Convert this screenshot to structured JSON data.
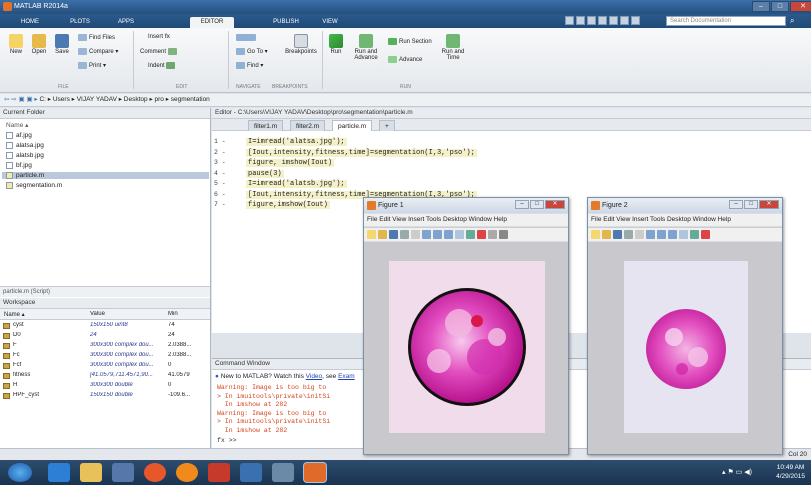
{
  "window": {
    "title": "MATLAB R2014a"
  },
  "tabs": [
    {
      "label": "HOME"
    },
    {
      "label": "PLOTS"
    },
    {
      "label": "APPS"
    },
    {
      "label": "EDITOR"
    },
    {
      "label": "PUBLISH"
    },
    {
      "label": "VIEW"
    }
  ],
  "search": {
    "placeholder": "Search Documentation"
  },
  "ribbon": {
    "new": "New",
    "open": "Open",
    "save": "Save",
    "find_files": "Find Files",
    "compare": "Compare ▾",
    "print": "Print ▾",
    "insert": "Insert",
    "comment": "Comment",
    "indent": "Indent",
    "go_to": "Go To ▾",
    "find": "Find ▾",
    "breakpoints": "Breakpoints",
    "run": "Run",
    "run_and_advance": "Run and Advance",
    "run_section": "Run Section",
    "advance": "Advance",
    "run_and_time": "Run and Time",
    "sections": {
      "file": "FILE",
      "edit": "EDIT",
      "navigate": "NAVIGATE",
      "breakpoints": "BREAKPOINTS",
      "run": "RUN"
    }
  },
  "path": {
    "crumbs": "C: ▸ Users ▸ VIJAY YADAV ▸ Desktop ▸ pro ▸ segmentation"
  },
  "current_folder": {
    "title": "Current Folder",
    "name_header": "Name ▴",
    "files": [
      "af.jpg",
      "alatsa.jpg",
      "alatsb.jpg",
      "bf.jpg",
      "particle.m",
      "segmentation.m"
    ],
    "selected": "particle.m",
    "details": "particle.m (Script)"
  },
  "workspace": {
    "title": "Workspace",
    "headers": [
      "Name ▴",
      "Value",
      "Min"
    ],
    "rows": [
      {
        "name": "cyst",
        "value": "150x150 uint8",
        "min": "74"
      },
      {
        "name": "D0",
        "value": "24",
        "min": "24"
      },
      {
        "name": "F",
        "value": "300x300 complex dou...",
        "min": "2.0388..."
      },
      {
        "name": "Fc",
        "value": "300x300 complex dou...",
        "min": "2.0388..."
      },
      {
        "name": "Fcf",
        "value": "300x300 complex dou...",
        "min": "0"
      },
      {
        "name": "fitness",
        "value": "[41.0579,711.4571,90...",
        "min": "41.0579"
      },
      {
        "name": "H",
        "value": "300x300 double",
        "min": "0"
      },
      {
        "name": "HPF_cyst",
        "value": "150x150 double",
        "min": "-109.6..."
      }
    ]
  },
  "editor": {
    "title": "Editor - C:\\Users\\VIJAY YADAV\\Desktop\\pro\\segmentation\\particle.m",
    "tabs": [
      "filter1.m",
      "filter2.m",
      "particle.m",
      "+"
    ],
    "line_numbers": [
      "1 -",
      "2 -",
      "3 -",
      "4 -",
      "5 -",
      "6 -",
      "7 -"
    ],
    "lines": [
      "I=imread('alatsa.jpg');",
      "[Iout,intensity,fitness,time]=segmentation(I,3,'pso');",
      "figure, imshow(Iout)",
      "pause(3)",
      "I=imread('alatsb.jpg');",
      "[Iout,intensity,fitness,time]=segmentation(I,3,'pso');",
      "figure,imshow(Iout)"
    ]
  },
  "command_window": {
    "title": "Command Window",
    "notice": "New to MATLAB? Watch this",
    "notice_link": "Video",
    "notice_tail": ", see",
    "notice_tail2": "Exam",
    "lines": [
      {
        "text": "Warning: Image is too big to",
        "cls": "red"
      },
      {
        "text": "> In imuitools\\private\\initSi",
        "cls": "red"
      },
      {
        "text": "  In imshow at 282",
        "cls": "red"
      },
      {
        "text": "Warning: Image is too big to",
        "cls": "red"
      },
      {
        "text": "> In imuitools\\private\\initSi",
        "cls": "red"
      },
      {
        "text": "  In imshow at 282",
        "cls": "red"
      }
    ],
    "prompt": "fx >>"
  },
  "figure1": {
    "title": "Figure 1",
    "menu": "File  Edit  View  Insert  Tools  Desktop  Window  Help"
  },
  "figure2": {
    "title": "Figure 2",
    "menu": "File  Edit  View  Insert  Tools  Desktop  Window  Help"
  },
  "status": {
    "right": "Col  20"
  },
  "taskbar": {
    "time": "10:49 AM",
    "date": "4/29/2015"
  }
}
